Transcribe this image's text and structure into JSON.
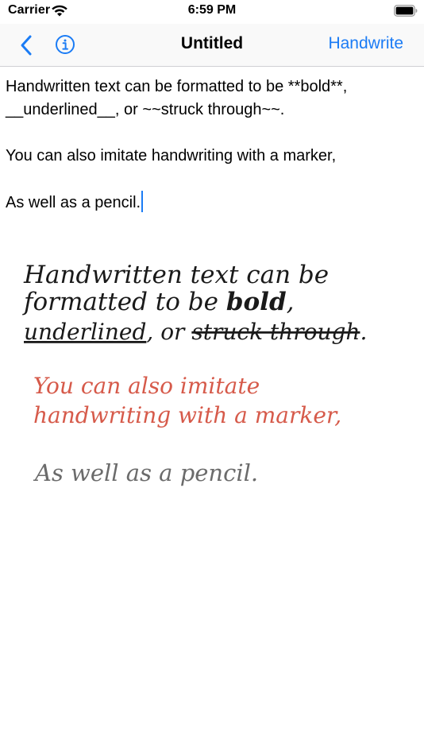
{
  "status_bar": {
    "carrier": "Carrier",
    "time": "6:59 PM",
    "icons": [
      "wifi-icon",
      "battery-icon"
    ]
  },
  "nav_bar": {
    "back_icon": "chevron-left-icon",
    "info_icon": "info-circle-icon",
    "title": "Untitled",
    "action_label": "Handwrite",
    "tint_color": "#1b7cf5"
  },
  "editor": {
    "paragraphs": [
      "Handwritten text can be formatted to be **bold**, __underlined__, or ~~struck through~~.",
      "You can also imitate handwriting with a marker,",
      "As well as a pencil."
    ]
  },
  "handwriting": {
    "line1a": "Handwritten text can be",
    "line1b_prefix": "formatted to be ",
    "line1b_bold": "bold",
    "line1b_suffix": ",",
    "line1c_underlined": "underlined",
    "line1c_mid": ", or ",
    "line1c_struck": "struck through",
    "line1c_end": ".",
    "line2a": "You can also imitate",
    "line2b": "handwriting with a marker,",
    "line3": "As well as a pencil.",
    "ink_color": "#1a1a1a",
    "marker_color": "#d65a4a",
    "pencil_color": "#6b6b6b"
  }
}
